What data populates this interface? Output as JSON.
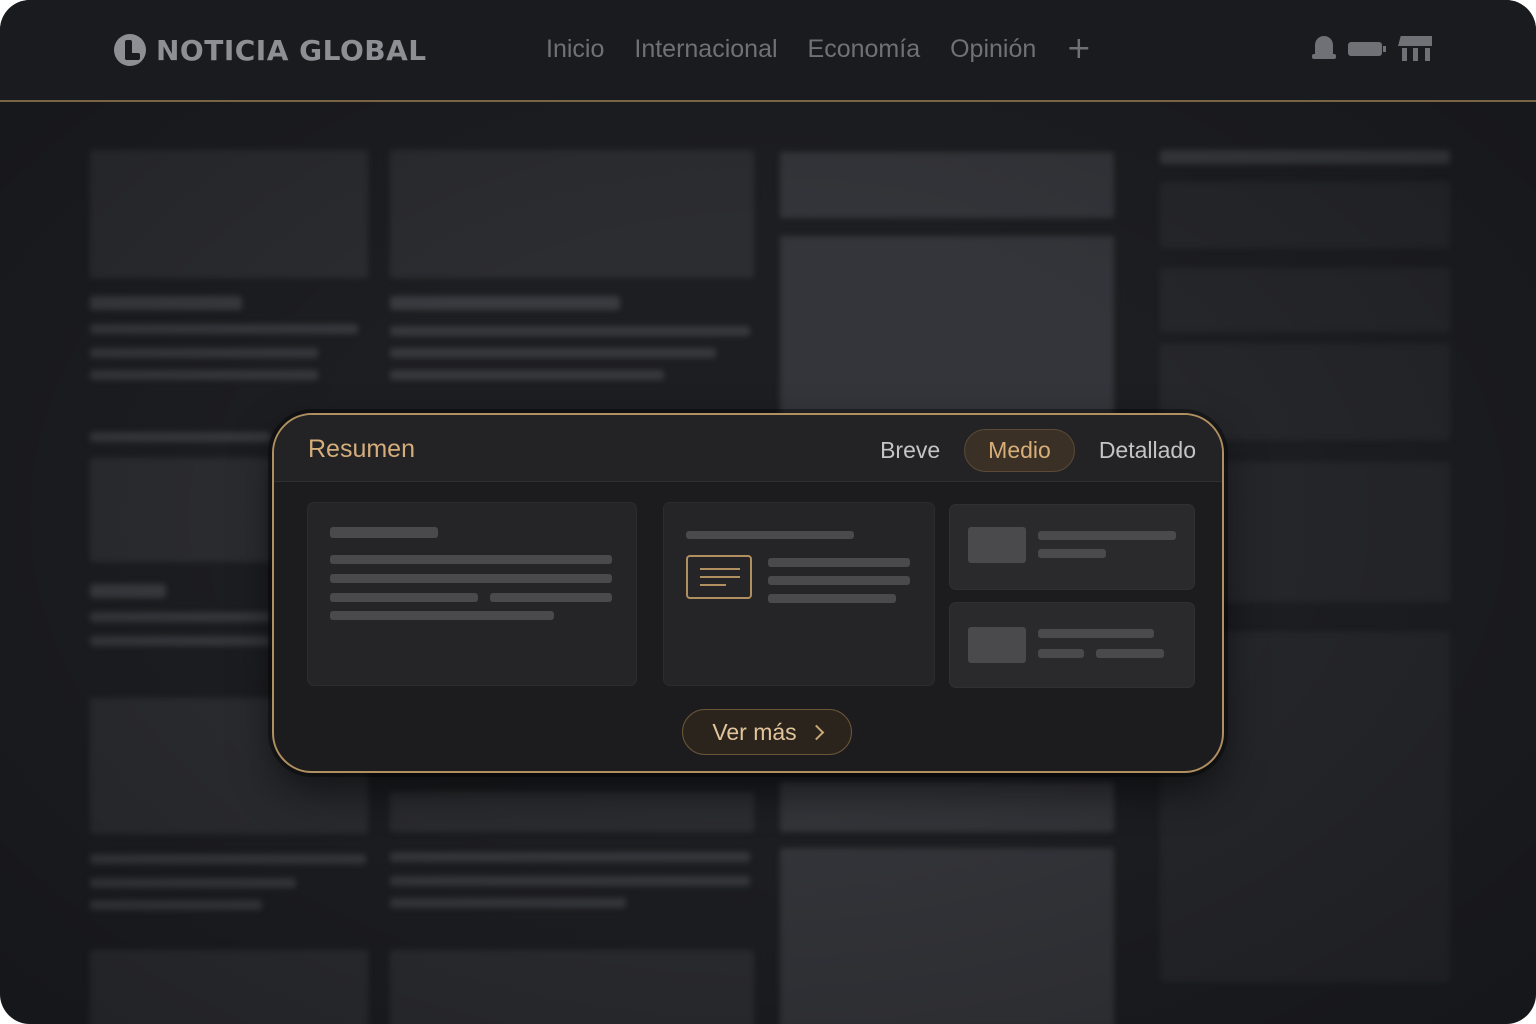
{
  "site": {
    "name": "NOTICIA GLOBAL",
    "logo_icon": "noticia-logo-icon"
  },
  "nav": {
    "items": [
      "Inicio",
      "Internacional",
      "Economía",
      "Opinión"
    ],
    "add_label": "+"
  },
  "top_icons": [
    "bell-icon",
    "battery-icon",
    "kiosk-icon"
  ],
  "summary": {
    "title": "Resumen",
    "tabs": [
      {
        "label": "Breve",
        "active": false
      },
      {
        "label": "Medio",
        "active": true
      },
      {
        "label": "Detallado",
        "active": false
      }
    ],
    "button_label": "Ver más",
    "button_icon": "chevron-right-icon"
  },
  "colors": {
    "accent": "#d4ad7a",
    "border": "#b08f60",
    "background": "#1d1e22"
  }
}
